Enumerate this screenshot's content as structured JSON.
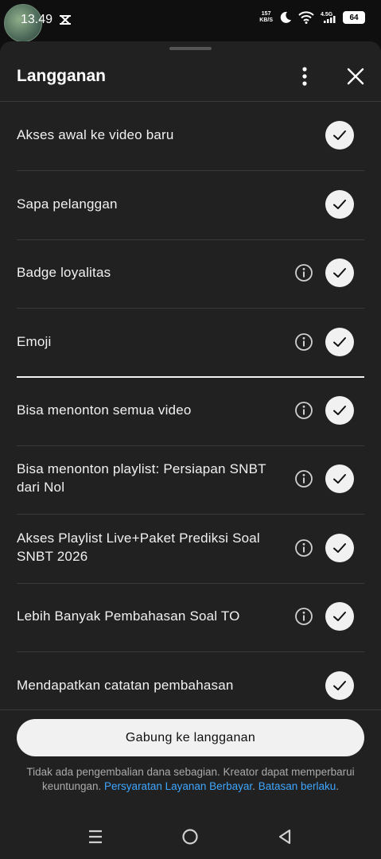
{
  "status": {
    "time": "13.49",
    "net_speed_value": "157",
    "net_speed_unit": "KB/S",
    "network": "4.5G",
    "battery": "64"
  },
  "sheet": {
    "title": "Langganan"
  },
  "items": [
    {
      "label": "Akses awal ke video baru",
      "has_info": false
    },
    {
      "label": "Sapa pelanggan",
      "has_info": false
    },
    {
      "label": "Badge loyalitas",
      "has_info": true
    },
    {
      "label": "Emoji",
      "has_info": true
    },
    {
      "label": "Bisa menonton semua video",
      "has_info": true
    },
    {
      "label": "Bisa menonton playlist: Persiapan SNBT dari Nol",
      "has_info": true
    },
    {
      "label": "Akses Playlist Live+Paket Prediksi Soal SNBT 2026",
      "has_info": true
    },
    {
      "label": "Lebih Banyak Pembahasan Soal TO",
      "has_info": true
    },
    {
      "label": "Mendapatkan catatan pembahasan",
      "has_info": false
    }
  ],
  "join_button": "Gabung ke langganan",
  "terms": {
    "text": "Tidak ada pengembalian dana sebagian. Kreator dapat memperbarui keuntungan.",
    "link1": "Persyaratan Layanan Berbayar",
    "sep": ".",
    "link2": "Batasan berlaku",
    "end": "."
  },
  "icons": {
    "more": "more-vertical-icon",
    "close": "close-icon",
    "info": "info-icon",
    "check": "check-icon",
    "nav_recent": "menu-icon",
    "nav_home": "home-circle-icon",
    "nav_back": "back-triangle-icon"
  }
}
